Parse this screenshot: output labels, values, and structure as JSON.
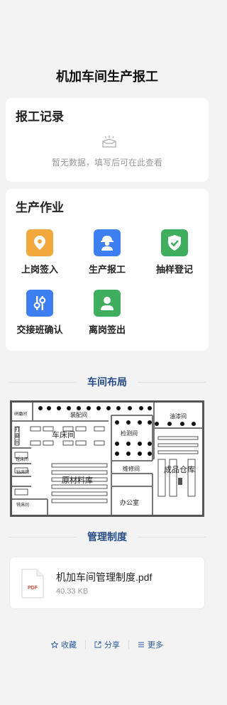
{
  "page": {
    "title": "机加车间生产报工"
  },
  "record": {
    "title": "报工记录",
    "empty_text": "暂无数据，填写后可在此查看",
    "empty_icon": "empty-box-icon"
  },
  "work": {
    "title": "生产作业",
    "items": [
      {
        "label": "上岗签入",
        "icon": "location-pin-icon",
        "color": "#f0a93a"
      },
      {
        "label": "生产报工",
        "icon": "worker-helmet-icon",
        "color": "#3d7ef0"
      },
      {
        "label": "抽样登记",
        "icon": "shield-check-icon",
        "color": "#3fae5f"
      },
      {
        "label": "交接班确认",
        "icon": "sliders-icon",
        "color": "#3d7ef0"
      },
      {
        "label": "离岗签出",
        "icon": "user-icon",
        "color": "#3fae5f"
      }
    ]
  },
  "layout_section": {
    "title": "车间布局",
    "rooms": [
      "研磨间",
      "装配间",
      "油漆间",
      "打磨间",
      "车床间",
      "检测间",
      "镗床间",
      "钻床间",
      "原材料库",
      "维修间",
      "成品仓库",
      "铣床间",
      "办公室"
    ]
  },
  "policy_section": {
    "title": "管理制度",
    "file": {
      "name": "机加车间管理制度.pdf",
      "size": "40.33 KB",
      "badge": "PDF"
    }
  },
  "actions": {
    "favorite": "收藏",
    "share": "分享",
    "more": "更多"
  },
  "colors": {
    "accent": "#274c86",
    "link": "#2a5a9a"
  }
}
